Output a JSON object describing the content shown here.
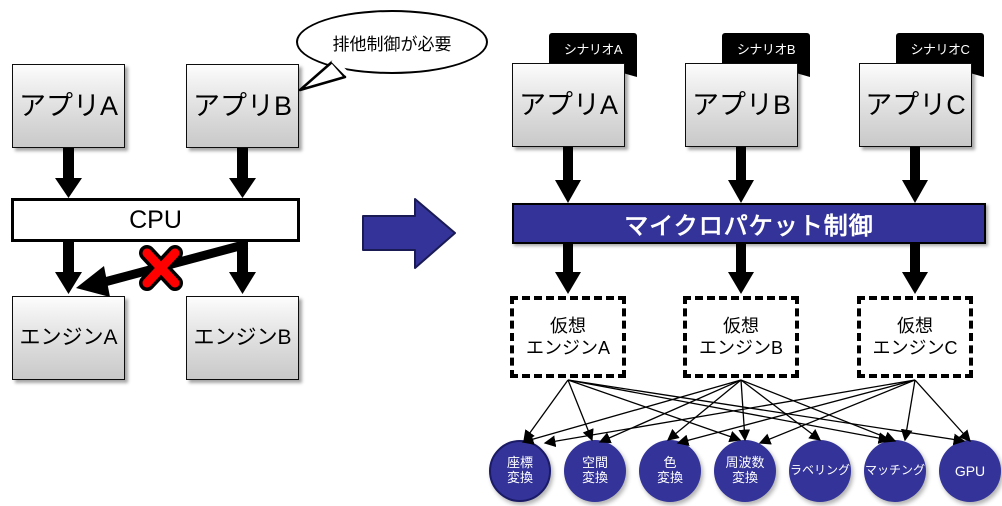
{
  "diagram": {
    "title": "Micropacket control virtualization diagram",
    "colors": {
      "navy": "#333399",
      "navy_dark": "#2e3192",
      "banner_black": "#000000",
      "error_red": "#ff0000",
      "box_gray": "#d9d9d9"
    }
  },
  "left": {
    "apps": [
      {
        "label": "アプリA"
      },
      {
        "label": "アプリB"
      }
    ],
    "cpu": {
      "label": "CPU"
    },
    "engines": [
      {
        "label": "エンジンA"
      },
      {
        "label": "エンジンB"
      }
    ],
    "callout": {
      "text": "排他制御が必要"
    },
    "blocked_marker": {
      "name": "red-x",
      "symbol": "✕"
    }
  },
  "transition": {
    "arrow": "→"
  },
  "right": {
    "apps": [
      {
        "label": "アプリA",
        "scenario": "シナリオA"
      },
      {
        "label": "アプリB",
        "scenario": "シナリオB"
      },
      {
        "label": "アプリC",
        "scenario": "シナリオC"
      }
    ],
    "control_bar": {
      "label": "マイクロパケット制御"
    },
    "virtual_engines": [
      {
        "line1": "仮想",
        "line2": "エンジンA"
      },
      {
        "line1": "仮想",
        "line2": "エンジンB"
      },
      {
        "line1": "仮想",
        "line2": "エンジンC"
      }
    ],
    "resources": [
      {
        "line1": "座標",
        "line2": "変換"
      },
      {
        "line1": "空間",
        "line2": "変換"
      },
      {
        "line1": "色",
        "line2": "変換"
      },
      {
        "line1": "周波数",
        "line2": "変換"
      },
      {
        "line1": "ラベリング",
        "line2": ""
      },
      {
        "line1": "マッチング",
        "line2": ""
      },
      {
        "line1": "GPU",
        "line2": ""
      }
    ]
  }
}
